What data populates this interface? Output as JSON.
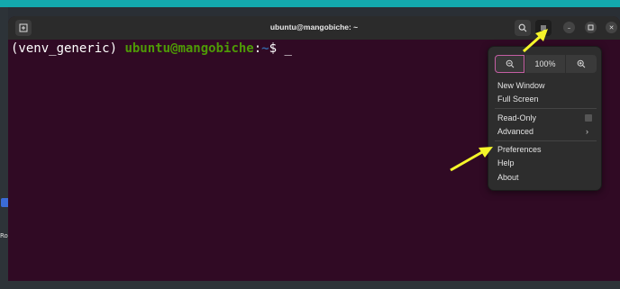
{
  "window": {
    "title": "ubuntu@mangobiche: ~"
  },
  "desktop": {
    "icon_label": "Roya"
  },
  "terminal": {
    "env": "(venv_generic) ",
    "user_host": "ubuntu@mangobiche",
    "colon": ":",
    "path": "~",
    "dollar": "$ ",
    "cursor": "_"
  },
  "menu": {
    "zoom_level": "100%",
    "items": {
      "new_window": "New Window",
      "full_screen": "Full Screen",
      "read_only": "Read-Only",
      "advanced": "Advanced",
      "preferences": "Preferences",
      "help": "Help",
      "about": "About"
    }
  },
  "icons": {
    "new_tab": "new-tab-icon",
    "search": "search-icon",
    "menu": "hamburger-menu-icon",
    "minimize": "minimize-icon",
    "maximize": "maximize-icon",
    "close": "close-icon",
    "zoom_out": "zoom-out-icon",
    "zoom_in": "zoom-in-icon",
    "submenu": "chevron-right-icon",
    "arrow_color": "#f5f52a"
  },
  "colors": {
    "terminal_bg": "#300a24",
    "prompt_user": "#4e9a06",
    "prompt_path": "#3465a4",
    "accent": "#c45ea3"
  }
}
